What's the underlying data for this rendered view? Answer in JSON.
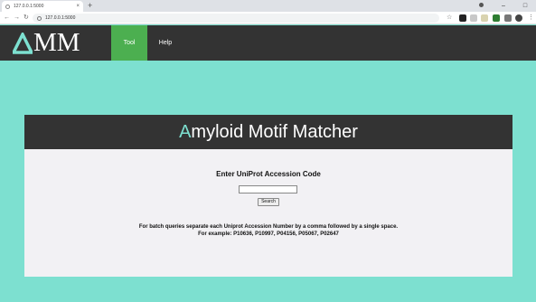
{
  "browser": {
    "tab_title": "127.0.0.1:5000",
    "tab_close": "×",
    "new_tab": "+",
    "url": "127.0.0.1:5000",
    "back": "←",
    "forward": "→",
    "reload": "↻",
    "star": "☆",
    "menu": "⋮",
    "window_minimize": "–",
    "window_maximize": "□",
    "window_close": "×"
  },
  "site": {
    "logo_text": "MM",
    "nav": {
      "tool_label": "Tool",
      "help_label": "Help",
      "active": "Tool"
    }
  },
  "main": {
    "title_first_letter": "A",
    "title_rest": "myloid Motif Matcher",
    "prompt": "Enter UniProt Accession Code",
    "input_value": "",
    "search_label": "Search",
    "note_line1": "For batch queries separate each Uniprot Accession Number by a comma followed by a single space.",
    "note_line2": "For example: P10636, P10997, P04156, P05067, P02647"
  },
  "colors": {
    "background": "#7de0d0",
    "dark": "#333333",
    "active_nav": "#4caf50",
    "accent": "#7de0d0",
    "card_body": "#f2f1f4"
  }
}
